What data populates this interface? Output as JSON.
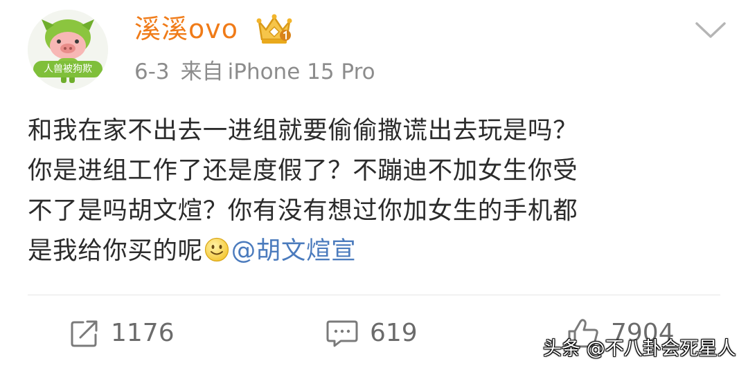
{
  "header": {
    "username": "溪溪ovo",
    "avatar_caption": "人兽被狗欺",
    "date": "6-3",
    "from_label": "来自",
    "device": "iPhone 15 Pro"
  },
  "content": {
    "line1": "和我在家不出去一进组就要偷偷撒谎出去玩是吗？",
    "line2": "你是进组工作了还是度假了？不蹦迪不加女生你受",
    "line3": "不了是吗胡文煊？你有没有想过你加女生的手机都",
    "line4_text": "是我给你买的呢",
    "mention": "@胡文煊宣"
  },
  "actions": {
    "repost_count": "1176",
    "comment_count": "619",
    "like_count": "7904"
  },
  "watermark": "头条 @不八卦会死星人",
  "colors": {
    "username": "#f07b18",
    "mention": "#4b7bbd",
    "meta": "#8c8c8c",
    "count": "#6b6b6b"
  },
  "icons": [
    "avatar-pig-icon",
    "vip-crown-badge-icon",
    "chevron-down-icon",
    "smile-emoji-icon",
    "repost-icon",
    "comment-icon",
    "like-icon"
  ]
}
